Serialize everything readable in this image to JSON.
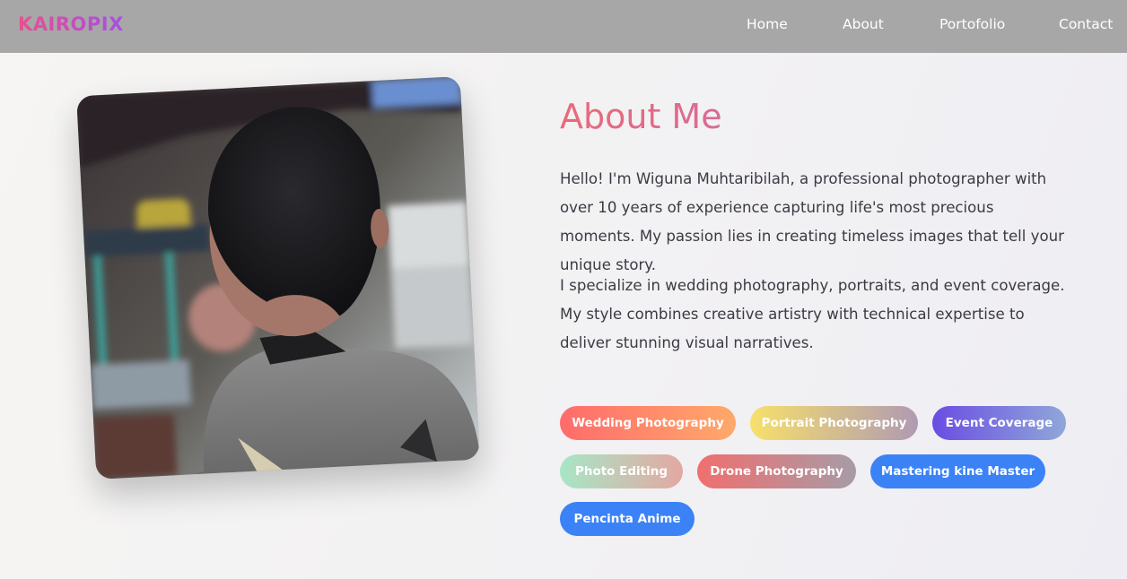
{
  "nav": {
    "logo": "KAIROPIX",
    "links": [
      "Home",
      "About",
      "Portofolio",
      "Contact"
    ]
  },
  "about": {
    "title": "About Me",
    "paragraphs": [
      "Hello! I'm Wiguna Muhtaribilah, a professional photographer with over 10 years of experience capturing life's most precious moments. My passion lies in creating timeless images that tell your unique story.",
      "I specialize in wedding photography, portraits, and event coverage. My style combines creative artistry with technical expertise to deliver stunning visual narratives."
    ],
    "tags": [
      "Wedding Photography",
      "Portrait Photography",
      "Event Coverage",
      "Photo Editing",
      "Drone Photography",
      "Mastering kine Master",
      "Pencinta Anime"
    ]
  },
  "colors": {
    "navbar_bg": "#a7a7a7",
    "logo_gradient": [
      "#e94f8f",
      "#a64ee8"
    ],
    "title_color": "#e96a7a",
    "text_color": "#3b3b44",
    "tag_blue": "#3b82f6"
  }
}
